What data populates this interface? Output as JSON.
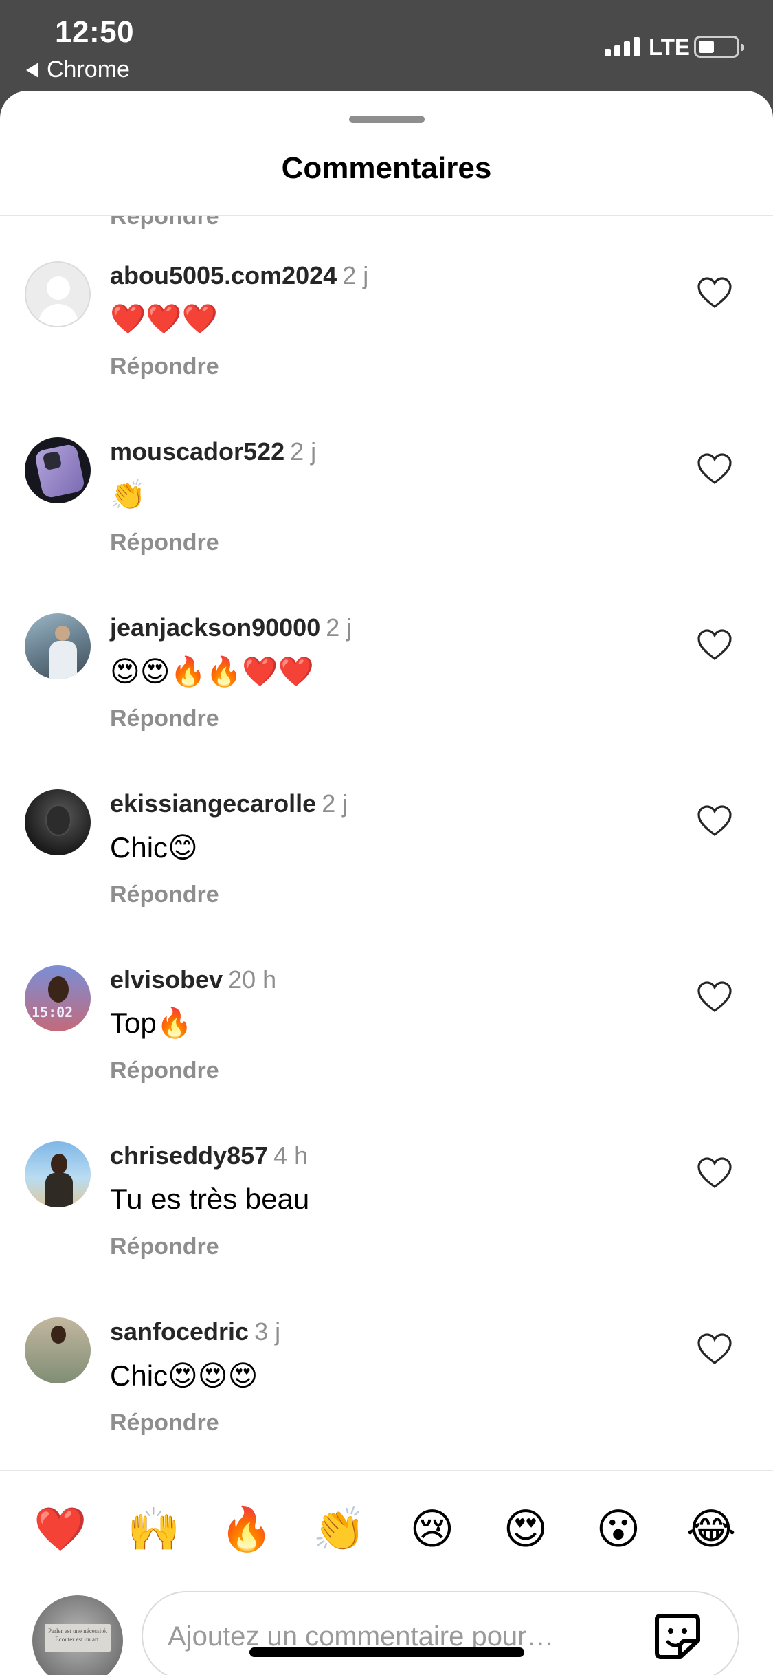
{
  "status_bar": {
    "time": "12:50",
    "back_app": "Chrome",
    "network": "LTE"
  },
  "sheet": {
    "title": "Commentaires",
    "partial_text": "Répondre"
  },
  "comments": [
    {
      "username": "abou5005.com2024",
      "time": "2 j",
      "text": "❤️❤️❤️",
      "reply": "Répondre",
      "avatar": "default-avatar"
    },
    {
      "username": "mouscador522",
      "time": "2 j",
      "text": "👏",
      "reply": "Répondre",
      "avatar": "phone-avatar"
    },
    {
      "username": "jeanjackson90000",
      "time": "2 j",
      "text": "😍😍🔥🔥❤️❤️",
      "reply": "Répondre",
      "avatar": "street-avatar"
    },
    {
      "username": "ekissiangecarolle",
      "time": "2 j",
      "text": "Chic😊",
      "reply": "Répondre",
      "avatar": "bw-avatar"
    },
    {
      "username": "elvisobev",
      "time": "20 h",
      "text": "Top🔥",
      "reply": "Répondre",
      "avatar": "selfie-avatar"
    },
    {
      "username": "chriseddy857",
      "time": "4 h",
      "text": "Tu es très beau",
      "reply": "Répondre",
      "avatar": "beach-avatar"
    },
    {
      "username": "sanfocedric",
      "time": "3 j",
      "text": "Chic😍😍😍",
      "reply": "Répondre",
      "avatar": "palm-avatar"
    }
  ],
  "quick_reactions": [
    "❤️",
    "🙌",
    "🔥",
    "👏",
    "😢",
    "😍",
    "😮",
    "😂"
  ],
  "composer": {
    "placeholder": "Ajoutez un commentaire pour…",
    "avatar_caption": "Parler est une nécessité. Ecouter est un art."
  },
  "icons": {
    "like": "heart-outline-icon",
    "sticker": "sticker-icon",
    "back": "back-triangle-icon"
  }
}
